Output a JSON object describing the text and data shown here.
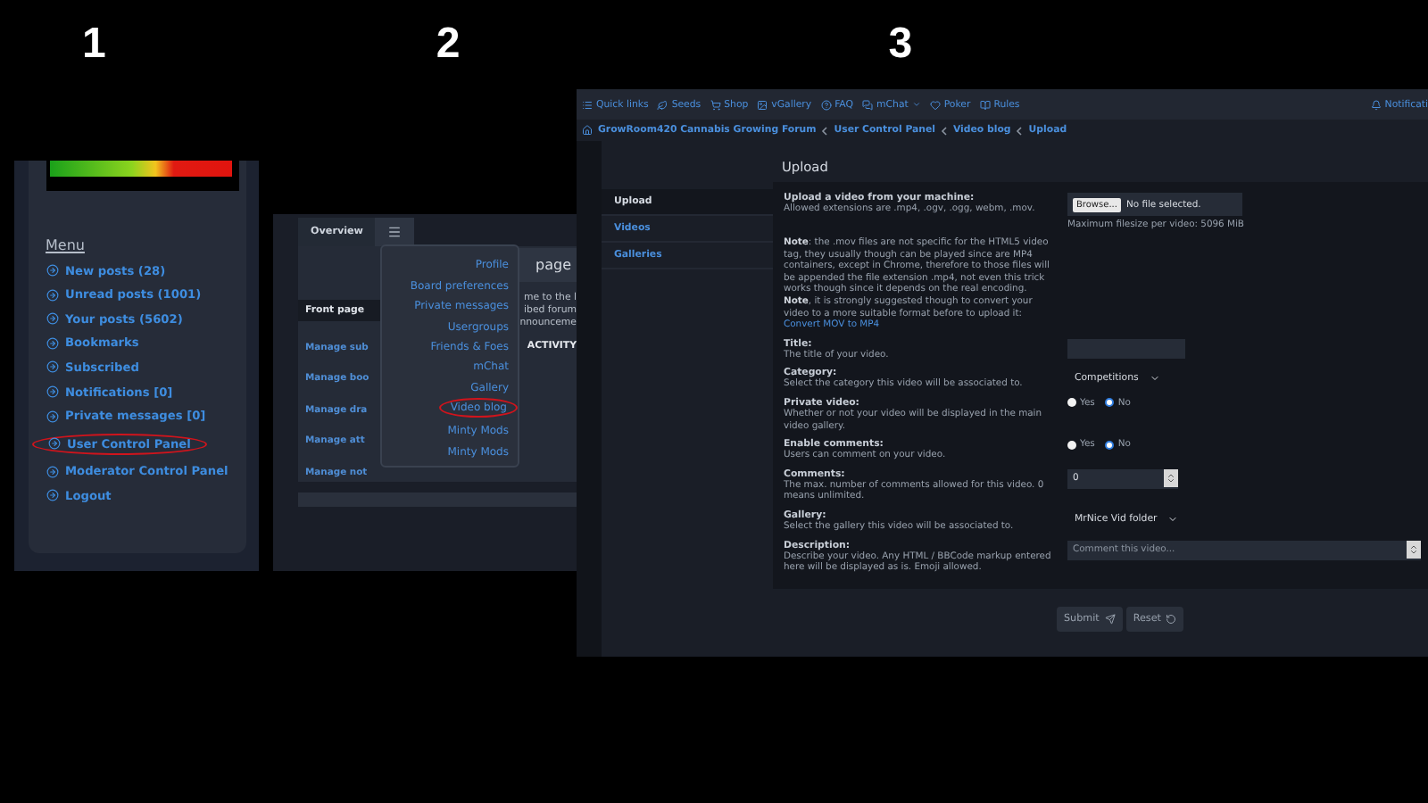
{
  "step_numbers": [
    "1",
    "2",
    "3"
  ],
  "panel_1": {
    "menu_title": "Menu",
    "items": [
      {
        "label": "New posts (28)",
        "circled": false
      },
      {
        "label": "Unread posts (1001)",
        "circled": false
      },
      {
        "label": "Your posts (5602)",
        "circled": false
      },
      {
        "label": "Bookmarks",
        "circled": false
      },
      {
        "label": "Subscribed",
        "circled": false
      },
      {
        "label": "Notifications [0]",
        "circled": false
      },
      {
        "label": "Private messages [0]",
        "circled": false
      },
      {
        "label": "User Control Panel",
        "circled": true
      },
      {
        "label": "Moderator Control Panel",
        "circled": false
      },
      {
        "label": "Logout",
        "circled": false
      }
    ]
  },
  "panel_2": {
    "tabs": [
      {
        "kind": "text",
        "label": "Overview",
        "selected": false
      },
      {
        "kind": "menu",
        "selected": true
      }
    ],
    "heading_fragment": "page",
    "front_page": "Front page",
    "links": [
      "Manage sub",
      "Manage boo",
      "Manage dra",
      "Manage att",
      "Manage not"
    ],
    "intro_fragments": [
      "me to the l",
      "ibed forum",
      "nnounceme"
    ],
    "activity": "ACTIVITY",
    "dropdown": [
      {
        "label": "Profile",
        "circled": false
      },
      {
        "label": "Board preferences",
        "circled": false
      },
      {
        "label": "Private messages",
        "circled": false
      },
      {
        "label": "Usergroups",
        "circled": false
      },
      {
        "label": "Friends & Foes",
        "circled": false
      },
      {
        "label": "mChat",
        "circled": false
      },
      {
        "label": "Gallery",
        "circled": false
      },
      {
        "label": "Video blog",
        "circled": true
      },
      {
        "label": "Minty Mods",
        "circled": false
      },
      {
        "label": "Minty Mods",
        "circled": false
      }
    ]
  },
  "panel_3": {
    "nav": [
      {
        "label": "Quick links",
        "caret": false
      },
      {
        "label": "Seeds",
        "caret": false
      },
      {
        "label": "Shop",
        "caret": false
      },
      {
        "label": "vGallery",
        "caret": false
      },
      {
        "label": "FAQ",
        "caret": false
      },
      {
        "label": "mChat",
        "caret": true
      },
      {
        "label": "Poker",
        "caret": false
      },
      {
        "label": "Rules",
        "caret": false
      }
    ],
    "notifications": "Notificati",
    "breadcrumb": [
      "GrowRoom420 Cannabis Growing Forum",
      "User Control Panel",
      "Video blog",
      "Upload"
    ],
    "sidebar": [
      {
        "label": "Upload",
        "selected": true
      },
      {
        "label": "Videos",
        "selected": false
      },
      {
        "label": "Galleries",
        "selected": false
      }
    ],
    "heading": "Upload",
    "fields": [
      {
        "kind": "file",
        "label": "Upload a video from your machine:",
        "hint": "Allowed extensions are .mp4, .ogv, .ogg, webm, .mov.",
        "button": "Browse...",
        "status": "No file selected.",
        "note": "Maximum filesize per video: 5096 MiB"
      },
      {
        "kind": "note",
        "text": "**Note**: the .mov files are not specific for the HTML5 video tag, they usually though can be played since are MP4 containers, except in Chrome, therefore to those files will be appended the file extension .mp4, not even this trick works though since it depends on the real encoding. **Note**, it is strongly suggested though to convert your video to a more suitable format before to upload it:",
        "link": "Convert MOV to MP4"
      },
      {
        "kind": "input",
        "label": "Title:",
        "hint": "The title of your video."
      },
      {
        "kind": "select",
        "label": "Category:",
        "hint": "Select the category this video will be associated to.",
        "value": "Competitions"
      },
      {
        "kind": "radio",
        "label": "Private video:",
        "hint": "Whether or not your video will be displayed in the main video gallery.",
        "options": [
          {
            "label": "Yes",
            "selected": false
          },
          {
            "label": "No",
            "selected": true
          }
        ]
      },
      {
        "kind": "radio",
        "label": "Enable comments:",
        "hint": "Users can comment on your video.",
        "options": [
          {
            "label": "Yes",
            "selected": false
          },
          {
            "label": "No",
            "selected": true
          }
        ]
      },
      {
        "kind": "number",
        "label": "Comments:",
        "hint": "The max. number of comments allowed for this video. 0 means unlimited.",
        "value": "0"
      },
      {
        "kind": "select",
        "label": "Gallery:",
        "hint": "Select the gallery this video will be associated to.",
        "value": "MrNice Vid folder"
      },
      {
        "kind": "textarea",
        "label": "Description:",
        "hint": "Describe your video. Any HTML / BBCode markup entered here will be displayed as is. Emoji allowed.",
        "placeholder": "Comment this video..."
      }
    ],
    "buttons": [
      {
        "label": "Submit",
        "kind": "submit"
      },
      {
        "label": "Reset",
        "kind": "reset"
      }
    ]
  }
}
